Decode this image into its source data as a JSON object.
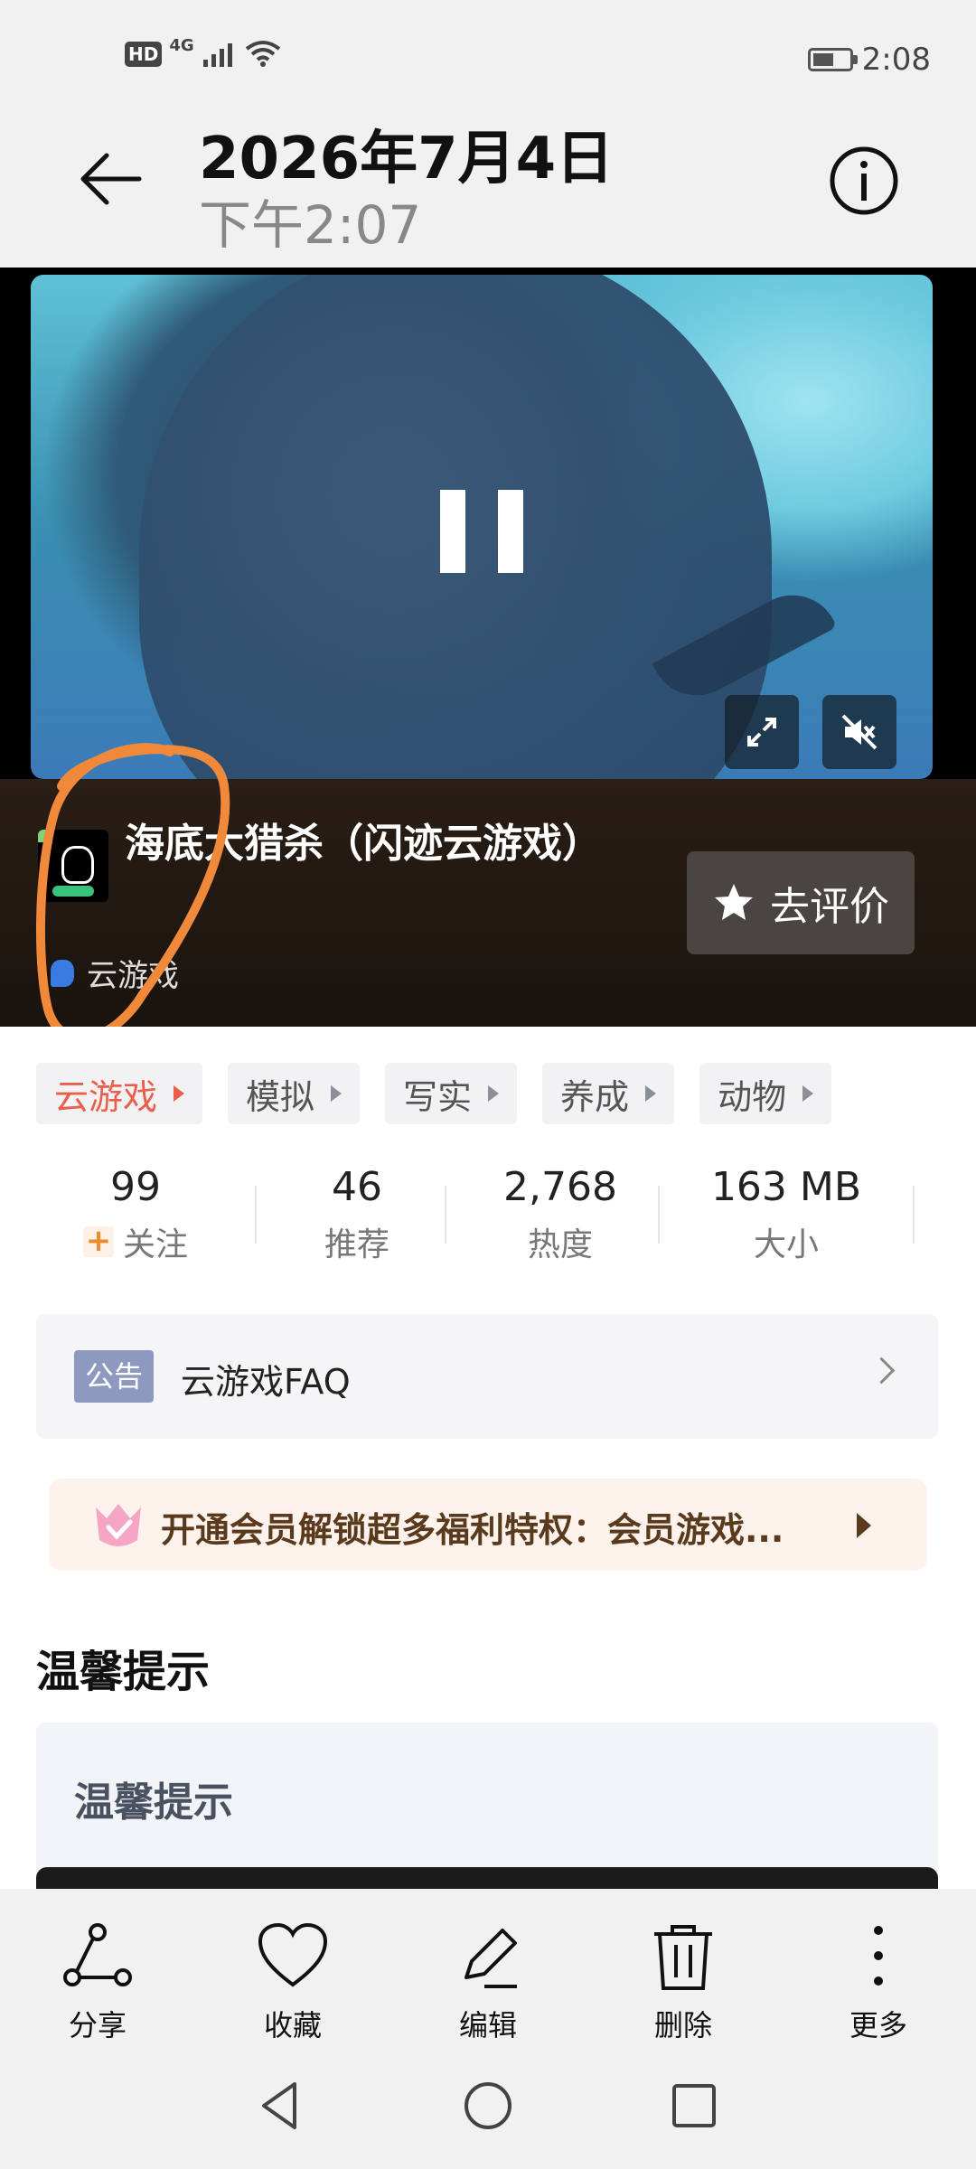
{
  "status_bar": {
    "hd": "HD",
    "network": "4G",
    "time": "2:08",
    "battery_level": 0.6
  },
  "header": {
    "date": "2026年7月4日",
    "time": "下午2:07"
  },
  "video": {
    "state": "paused"
  },
  "game": {
    "title": "海底大猎杀（闪迹云游戏）",
    "category": "云游戏",
    "rate_label": "去评价"
  },
  "tags": [
    {
      "label": "云游戏",
      "active": true
    },
    {
      "label": "模拟",
      "active": false
    },
    {
      "label": "写实",
      "active": false
    },
    {
      "label": "养成",
      "active": false
    },
    {
      "label": "动物",
      "active": false
    }
  ],
  "stats": [
    {
      "value": "99",
      "label": "关注"
    },
    {
      "value": "46",
      "label": "推荐"
    },
    {
      "value": "2,768",
      "label": "热度"
    },
    {
      "value": "163 MB",
      "label": "大小"
    }
  ],
  "notice": {
    "badge": "公告",
    "text": "云游戏FAQ"
  },
  "vip_banner": {
    "text": "开通会员解锁超多福利特权：会员游戏..."
  },
  "section": {
    "title": "温馨提示",
    "card_title": "温馨提示"
  },
  "actions": [
    {
      "icon": "share-icon",
      "label": "分享"
    },
    {
      "icon": "heart-icon",
      "label": "收藏"
    },
    {
      "icon": "edit-icon",
      "label": "编辑"
    },
    {
      "icon": "trash-icon",
      "label": "删除"
    },
    {
      "icon": "more-icon",
      "label": "更多"
    }
  ],
  "colors": {
    "accent": "#e8604c",
    "annotation": "#f0893a",
    "vip_text": "#5a3a1c"
  }
}
